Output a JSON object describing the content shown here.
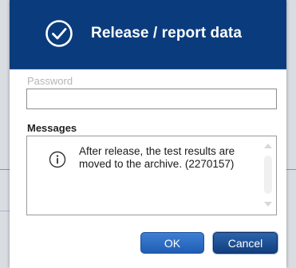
{
  "dialog": {
    "title": "Release / report data",
    "title_icon": "checkmark-circle-icon",
    "password_label": "Password",
    "password_value": "",
    "messages_label": "Messages",
    "message_icon": "info-icon",
    "message_text": "After release, the test results are moved to the archive. (2270157)",
    "ok_label": "OK",
    "cancel_label": "Cancel"
  },
  "colors": {
    "titlebar": "#0a3c7d",
    "ok_button": "#2e6ec4",
    "cancel_button": "#1f4f92"
  }
}
